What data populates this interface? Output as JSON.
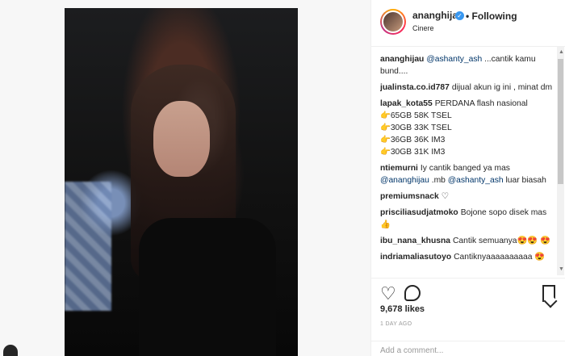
{
  "post": {
    "username": "ananghijau",
    "verified_icon": "verified-badge-icon",
    "separator": "•",
    "follow_label": "Following",
    "location": "Cinere"
  },
  "comments": [
    {
      "user": "ananghijau",
      "mention": "@ashanty_ash",
      "text": " ...cantik kamu bund...."
    },
    {
      "user": "jualinsta.co.id787",
      "text": "dijual akun ig ini , minat dm"
    },
    {
      "user": "lapak_kota55",
      "text": "PERDANA flash nasional"
    },
    {
      "line": "👉65GB 58K TSEL"
    },
    {
      "line": "👉30GB 33K TSEL"
    },
    {
      "line": "👉36GB 36K IM3"
    },
    {
      "line": "👉30GB 31K IM3"
    },
    {
      "user": "ntiemurni",
      "text": "Iy cantik banged ya mas ",
      "mention1": "@ananghijau",
      "middle": " .mb ",
      "mention2": "@ashanty_ash",
      "end": " luar biasah"
    },
    {
      "user": "premiumsnack",
      "text": "♡"
    },
    {
      "user": "prisciliasudjatmoko",
      "text": "Bojone sopo disek mas 👍"
    },
    {
      "user": "ibu_nana_khusna",
      "text": "Cantik semuanya😍😍 😍"
    },
    {
      "user": "indriamaliasutoyo",
      "text": "Cantiknyaaaaaaaaaa 😍"
    }
  ],
  "actions": {
    "heart_icon": "heart-icon",
    "comment_icon": "comment-icon",
    "bookmark_icon": "bookmark-icon",
    "likes": "9,678 likes",
    "time": "1 DAY AGO",
    "add_comment_placeholder": "Add a comment..."
  },
  "colors": {
    "link": "#003569",
    "verified": "#3897f0",
    "text": "#262626",
    "muted": "#999999"
  }
}
